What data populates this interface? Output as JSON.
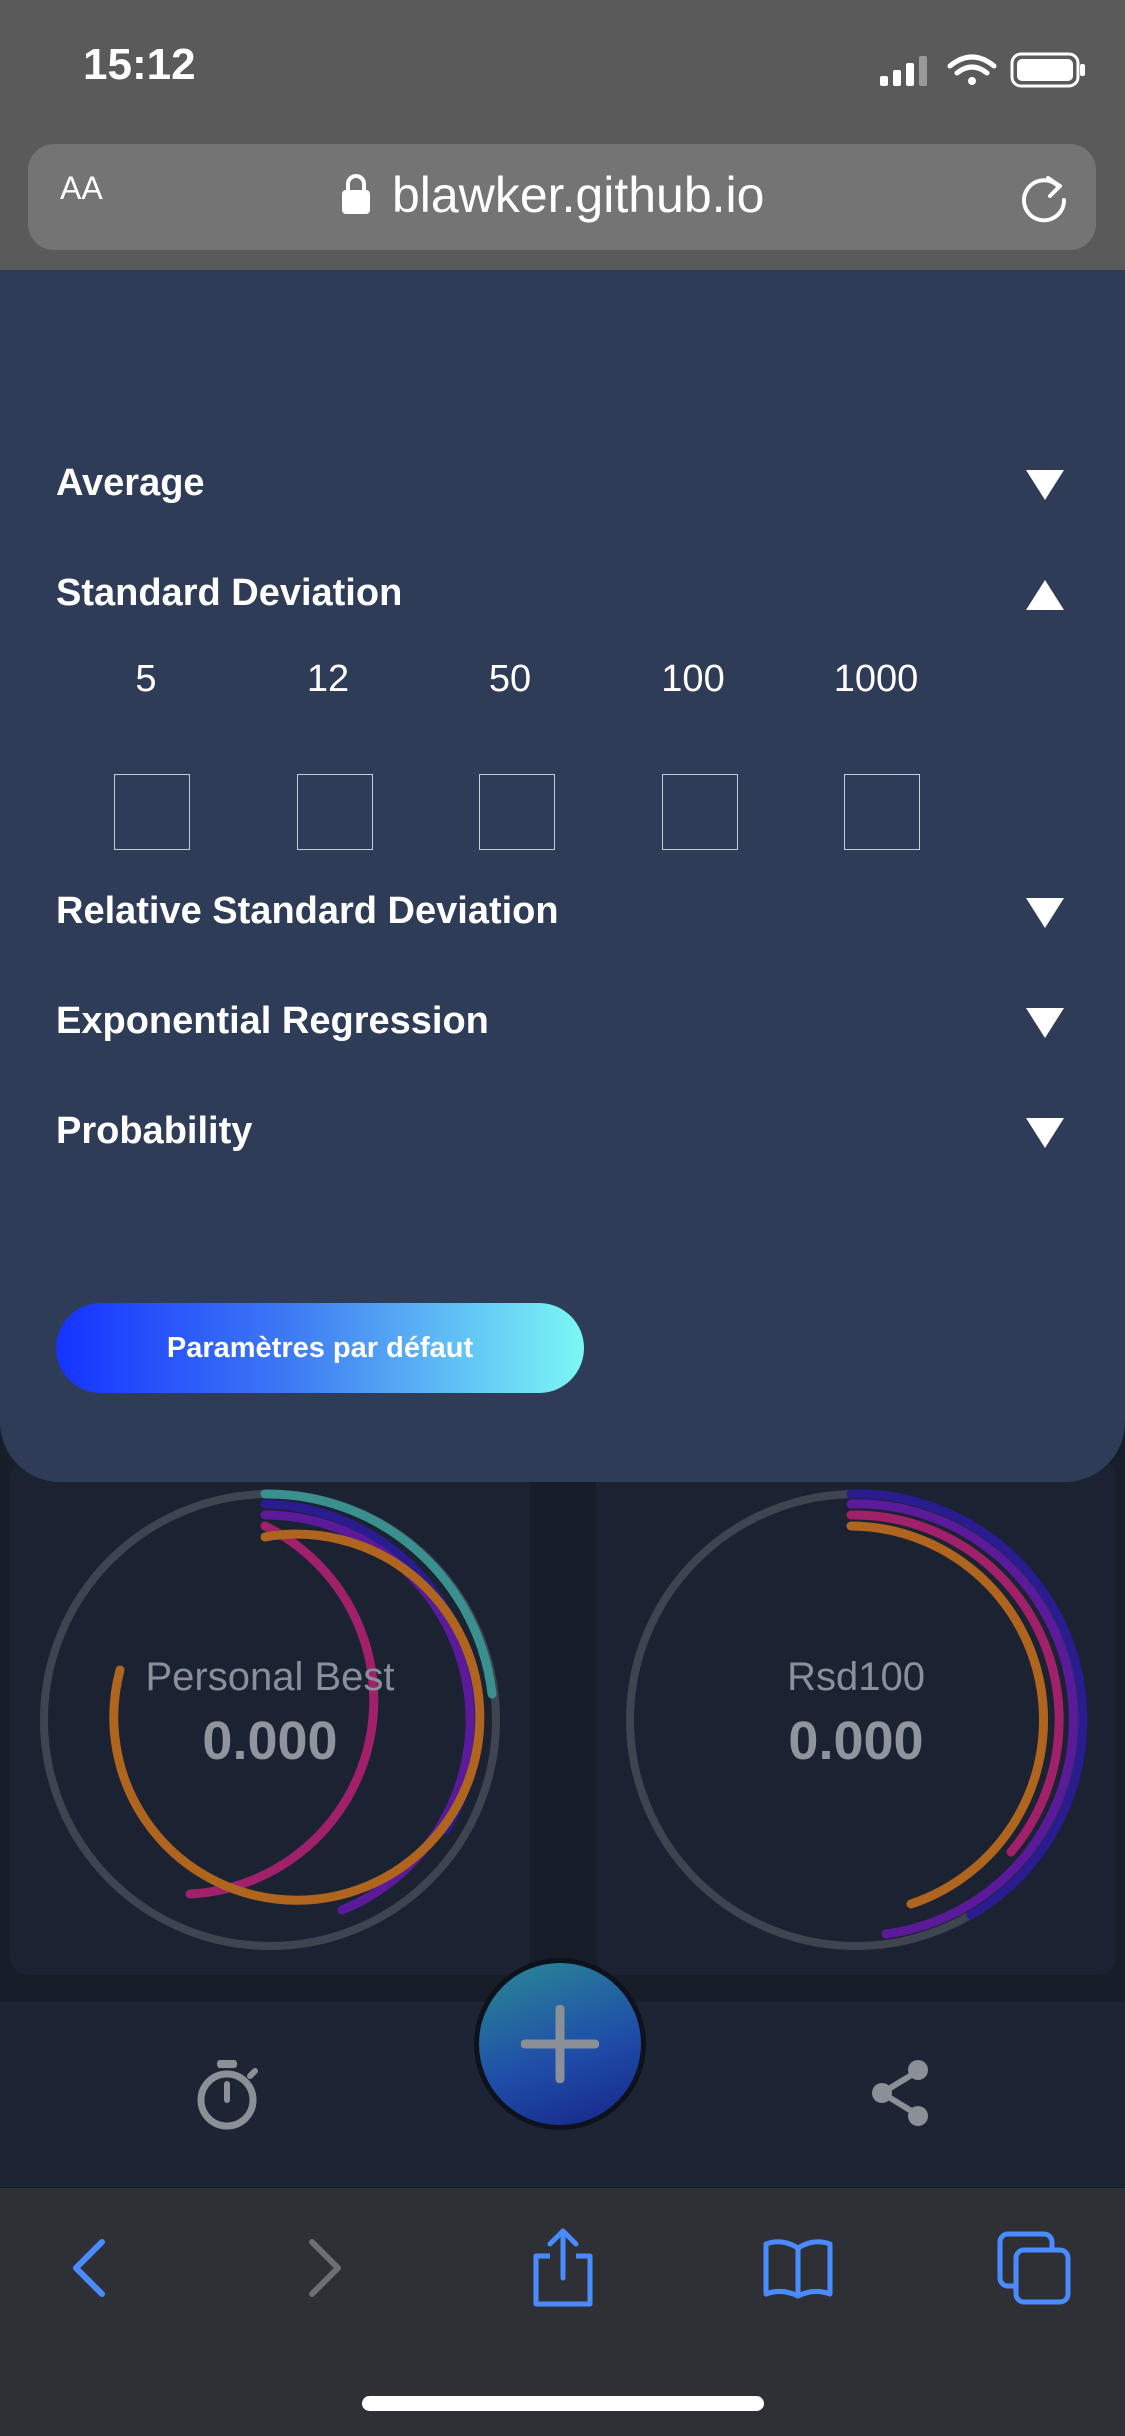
{
  "status_bar": {
    "time": "15:12"
  },
  "browser": {
    "text_size_label": "AA",
    "url": "blawker.github.io"
  },
  "settings": {
    "rows": [
      {
        "label": "Average",
        "expanded": false
      },
      {
        "label": "Standard Deviation",
        "expanded": true
      },
      {
        "label": "Relative Standard Deviation",
        "expanded": false
      },
      {
        "label": "Exponential Regression",
        "expanded": false
      },
      {
        "label": "Probability",
        "expanded": false
      }
    ],
    "std_periods": [
      "5",
      "12",
      "50",
      "100",
      "1000"
    ],
    "std_checked": [
      false,
      false,
      false,
      false,
      false
    ],
    "defaults_button": "Paramètres par défaut"
  },
  "gauges": [
    {
      "label": "Personal Best",
      "value": "0.000"
    },
    {
      "label": "Rsd100",
      "value": "0.000"
    }
  ],
  "app_bar": {
    "left_icon": "stopwatch-icon",
    "center_icon": "plus-icon",
    "right_icon": "share-icon"
  },
  "safari_toolbar": {
    "icons": [
      "back-icon",
      "forward-icon",
      "share-icon",
      "bookmarks-icon",
      "tabs-icon"
    ]
  },
  "colors": {
    "panel": "#2f3c57",
    "gauge_teal": "#3a8f8f",
    "gauge_indigo": "#2a1b8f",
    "gauge_purple": "#5a1a9a",
    "gauge_magenta": "#a0206a",
    "gauge_orange": "#b0651f",
    "gauge_track": "#3f4550",
    "safari_blue": "#4a8cff"
  }
}
